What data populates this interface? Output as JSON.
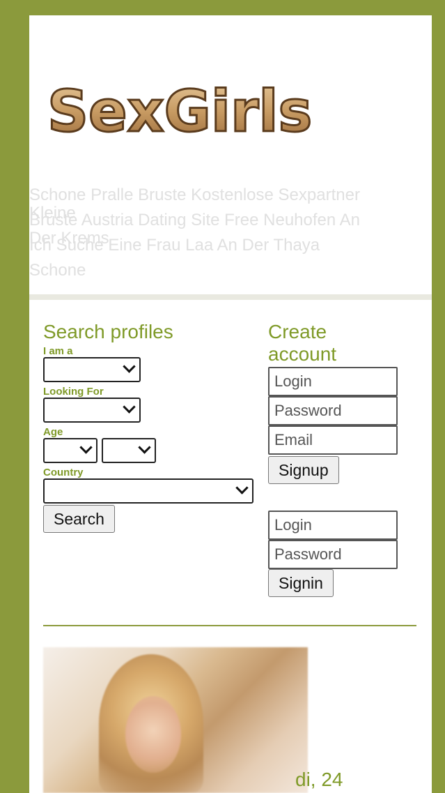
{
  "header": {
    "logo_text": "SexGirls",
    "line1": "Schone Pralle Bruste Kostenlose Sexpartner",
    "line2a": "Kleine",
    "line2b": "Bruste Austria Dating Site Free Neuhofen An",
    "line3a": "Der Krems",
    "line3b": "Ich Suche Eine Frau Laa An Der Thaya",
    "line4": "Schone"
  },
  "search": {
    "title": "Search profiles",
    "i_am_label": "I am a",
    "looking_for_label": "Looking For",
    "age_label": "Age",
    "country_label": "Country",
    "search_button": "Search"
  },
  "create": {
    "title_line1": "Create",
    "title_line2": "account",
    "login_placeholder": "Login",
    "password_placeholder": "Password",
    "email_placeholder": "Email",
    "signup_button": "Signup"
  },
  "signin": {
    "login_placeholder": "Login",
    "password_placeholder": "Password",
    "signin_button": "Signin"
  },
  "profile": {
    "name_age": "di, 24"
  },
  "colors": {
    "frame": "#8b9a3c",
    "accent_text": "#7f9a28"
  }
}
